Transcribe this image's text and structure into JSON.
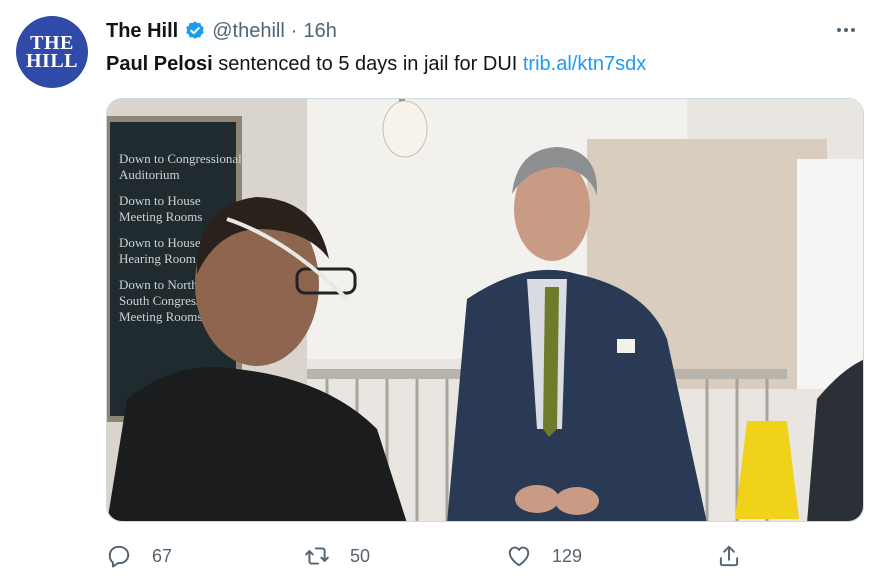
{
  "author": {
    "avatar_line1": "THE",
    "avatar_line2": "HILL",
    "name": "The Hill",
    "handle": "@thehill",
    "separator": "·",
    "time": "16h",
    "verified_icon": "verified-badge-icon"
  },
  "tweet": {
    "bold": "Paul Pelosi",
    "text": " sentenced to 5 days in jail for DUI ",
    "link": "trib.al/ktn7sdx"
  },
  "media": {
    "sign_lines": [
      "Down to Congressional",
      "Auditorium",
      "Down to House",
      "Meeting Rooms",
      "Down to House",
      "Hearing Room",
      "Down to North a",
      "South Congression",
      "Meeting Rooms"
    ]
  },
  "actions": {
    "replies": "67",
    "retweets": "50",
    "likes": "129"
  },
  "colors": {
    "link": "#1d9bf0",
    "muted": "#536471",
    "brand": "#2f4aa8"
  }
}
